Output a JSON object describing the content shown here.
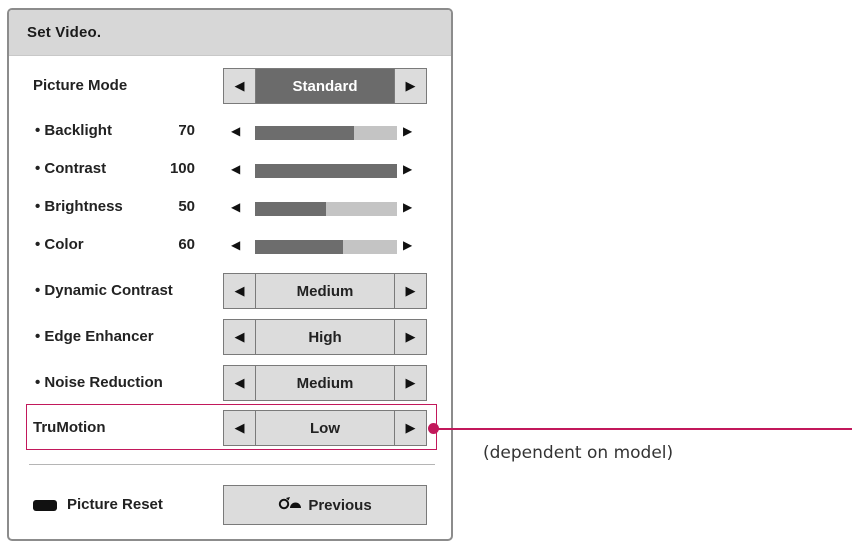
{
  "panel": {
    "title": "Set Video."
  },
  "picture_mode": {
    "label": "Picture Mode",
    "value": "Standard"
  },
  "sliders": [
    {
      "label": "• Backlight",
      "value": "70",
      "level": 0.7
    },
    {
      "label": "• Contrast",
      "value": "100",
      "level": 1.0
    },
    {
      "label": "• Brightness",
      "value": "50",
      "level": 0.5
    },
    {
      "label": "• Color",
      "value": "60",
      "level": 0.62
    }
  ],
  "options": [
    {
      "label": "• Dynamic Contrast",
      "value": "Medium"
    },
    {
      "label": "• Edge Enhancer",
      "value": "High"
    },
    {
      "label": "• Noise Reduction",
      "value": "Medium"
    }
  ],
  "trumotion": {
    "label": "TruMotion",
    "value": "Low"
  },
  "footer": {
    "reset_label": "Picture Reset",
    "previous_label": "Previous"
  },
  "callout": {
    "text": "(dependent on model)"
  },
  "icons": {
    "left_arrow": "left-triangle-icon",
    "right_arrow": "right-triangle-icon",
    "back": "back-icon"
  },
  "colors": {
    "accent": "#c2185b",
    "selected_bg": "#6b6b6b",
    "slider_fill": "#6d6d6d",
    "slider_track": "#c4c4c4"
  }
}
